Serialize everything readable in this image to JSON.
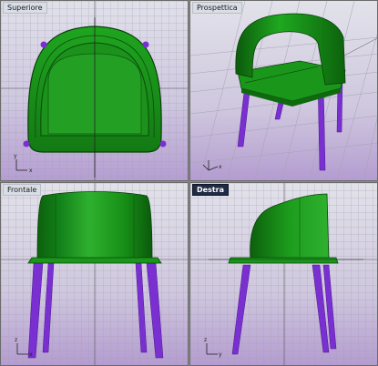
{
  "viewports": [
    {
      "key": "top",
      "title": "Superiore",
      "active": false
    },
    {
      "key": "persp",
      "title": "Prospettica",
      "active": false
    },
    {
      "key": "front",
      "title": "Frontale",
      "active": false
    },
    {
      "key": "right",
      "title": "Destra",
      "active": true
    }
  ],
  "axis_labels": {
    "x": "x",
    "y": "y",
    "z": "z"
  },
  "colors": {
    "grid_bg_top": "#dcdce6",
    "grid_bg_bottom": "#b8a4cf",
    "grid_line": "#a9a9b3",
    "grid_major": "#8f8f9a",
    "seat_green": "#1f8f1f",
    "seat_green_dark": "#0d5a0d",
    "leg_purple": "#7a2fd0",
    "active_title_bg": "#1f2a44"
  }
}
